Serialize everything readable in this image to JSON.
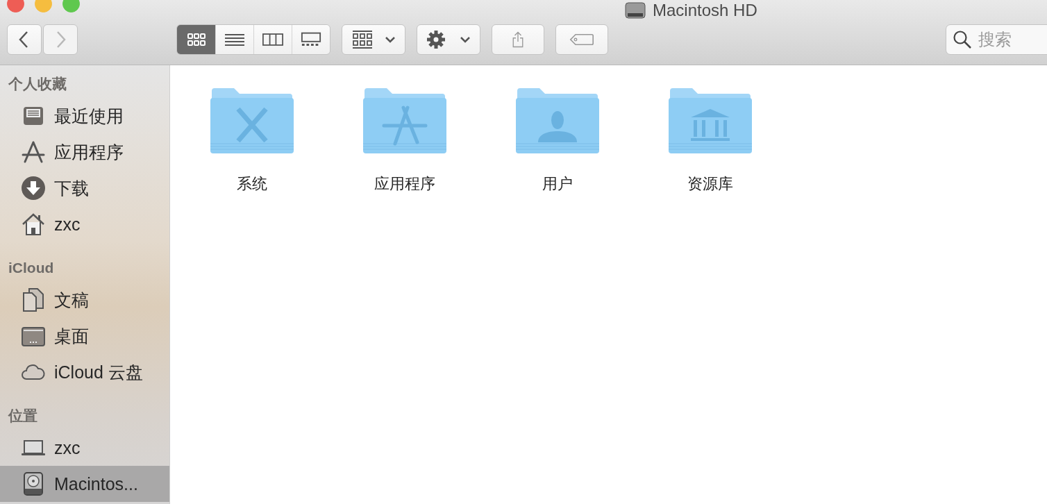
{
  "window": {
    "title": "Macintosh HD"
  },
  "toolbar": {
    "nav": [
      {
        "kind": "back",
        "disabled": false
      },
      {
        "kind": "forward",
        "disabled": true
      }
    ],
    "view_modes": [
      {
        "kind": "icons",
        "selected": true
      },
      {
        "kind": "list",
        "selected": false
      },
      {
        "kind": "columns",
        "selected": false
      },
      {
        "kind": "gallery",
        "selected": false
      }
    ],
    "actions": [
      {
        "kind": "group"
      },
      {
        "kind": "action"
      },
      {
        "kind": "share"
      },
      {
        "kind": "tag"
      }
    ],
    "search": {
      "placeholder": "搜索"
    }
  },
  "sidebar": {
    "sections": [
      {
        "heading": "个人收藏",
        "items": [
          {
            "label": "最近使用",
            "kind": "recents",
            "selected": false
          },
          {
            "label": "应用程序",
            "kind": "apps",
            "selected": false
          },
          {
            "label": "下载",
            "kind": "downloads",
            "selected": false
          },
          {
            "label": "zxc",
            "kind": "home",
            "selected": false
          }
        ]
      },
      {
        "heading": "iCloud",
        "items": [
          {
            "label": "文稿",
            "kind": "documents",
            "selected": false
          },
          {
            "label": "桌面",
            "kind": "desktop",
            "selected": false
          },
          {
            "label": "iCloud 云盘",
            "kind": "cloud",
            "selected": false
          }
        ]
      },
      {
        "heading": "位置",
        "items": [
          {
            "label": "zxc",
            "kind": "laptop",
            "selected": false
          },
          {
            "label": "Macintos...",
            "kind": "disk",
            "selected": true
          }
        ]
      }
    ]
  },
  "folders": [
    {
      "name": "系统",
      "kind": "system"
    },
    {
      "name": "应用程序",
      "kind": "apps"
    },
    {
      "name": "用户",
      "kind": "users"
    },
    {
      "name": "资源库",
      "kind": "library"
    }
  ]
}
